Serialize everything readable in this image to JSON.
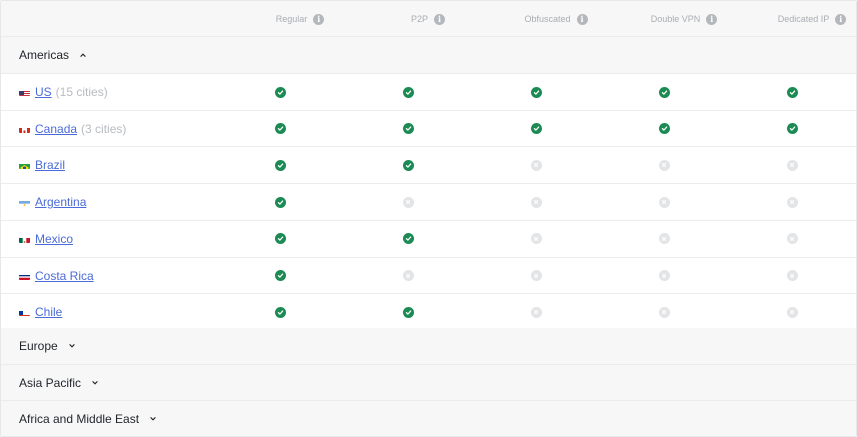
{
  "columns": [
    {
      "label": "Regular"
    },
    {
      "label": "P2P"
    },
    {
      "label": "Obfuscated"
    },
    {
      "label": "Double VPN"
    },
    {
      "label": "Dedicated IP"
    }
  ],
  "groups": {
    "americas": {
      "label": "Americas",
      "expanded": true
    },
    "europe": {
      "label": "Europe",
      "expanded": false
    },
    "asia_pacific": {
      "label": "Asia Pacific",
      "expanded": false
    },
    "africa_middle_east": {
      "label": "Africa and Middle East",
      "expanded": false
    }
  },
  "rows": [
    {
      "country": "US",
      "cities": "(15 cities)",
      "flag": "us",
      "support": [
        true,
        true,
        true,
        true,
        true
      ]
    },
    {
      "country": "Canada",
      "cities": "(3 cities)",
      "flag": "ca",
      "support": [
        true,
        true,
        true,
        true,
        true
      ]
    },
    {
      "country": "Brazil",
      "cities": "",
      "flag": "br",
      "support": [
        true,
        true,
        false,
        false,
        false
      ]
    },
    {
      "country": "Argentina",
      "cities": "",
      "flag": "ar",
      "support": [
        true,
        false,
        false,
        false,
        false
      ]
    },
    {
      "country": "Mexico",
      "cities": "",
      "flag": "mx",
      "support": [
        true,
        true,
        false,
        false,
        false
      ]
    },
    {
      "country": "Costa Rica",
      "cities": "",
      "flag": "cr",
      "support": [
        true,
        false,
        false,
        false,
        false
      ]
    },
    {
      "country": "Chile",
      "cities": "",
      "flag": "cl",
      "support": [
        true,
        true,
        false,
        false,
        false
      ]
    }
  ],
  "colors": {
    "supported": "#1b8a53",
    "unsupported": "#e3e4e6",
    "link": "#4b6bd6"
  },
  "icons": {
    "supported": "check-circle-icon",
    "unsupported": "x-circle-icon",
    "info": "info-icon",
    "expanded": "chevron-up-icon",
    "collapsed": "chevron-down-icon"
  }
}
